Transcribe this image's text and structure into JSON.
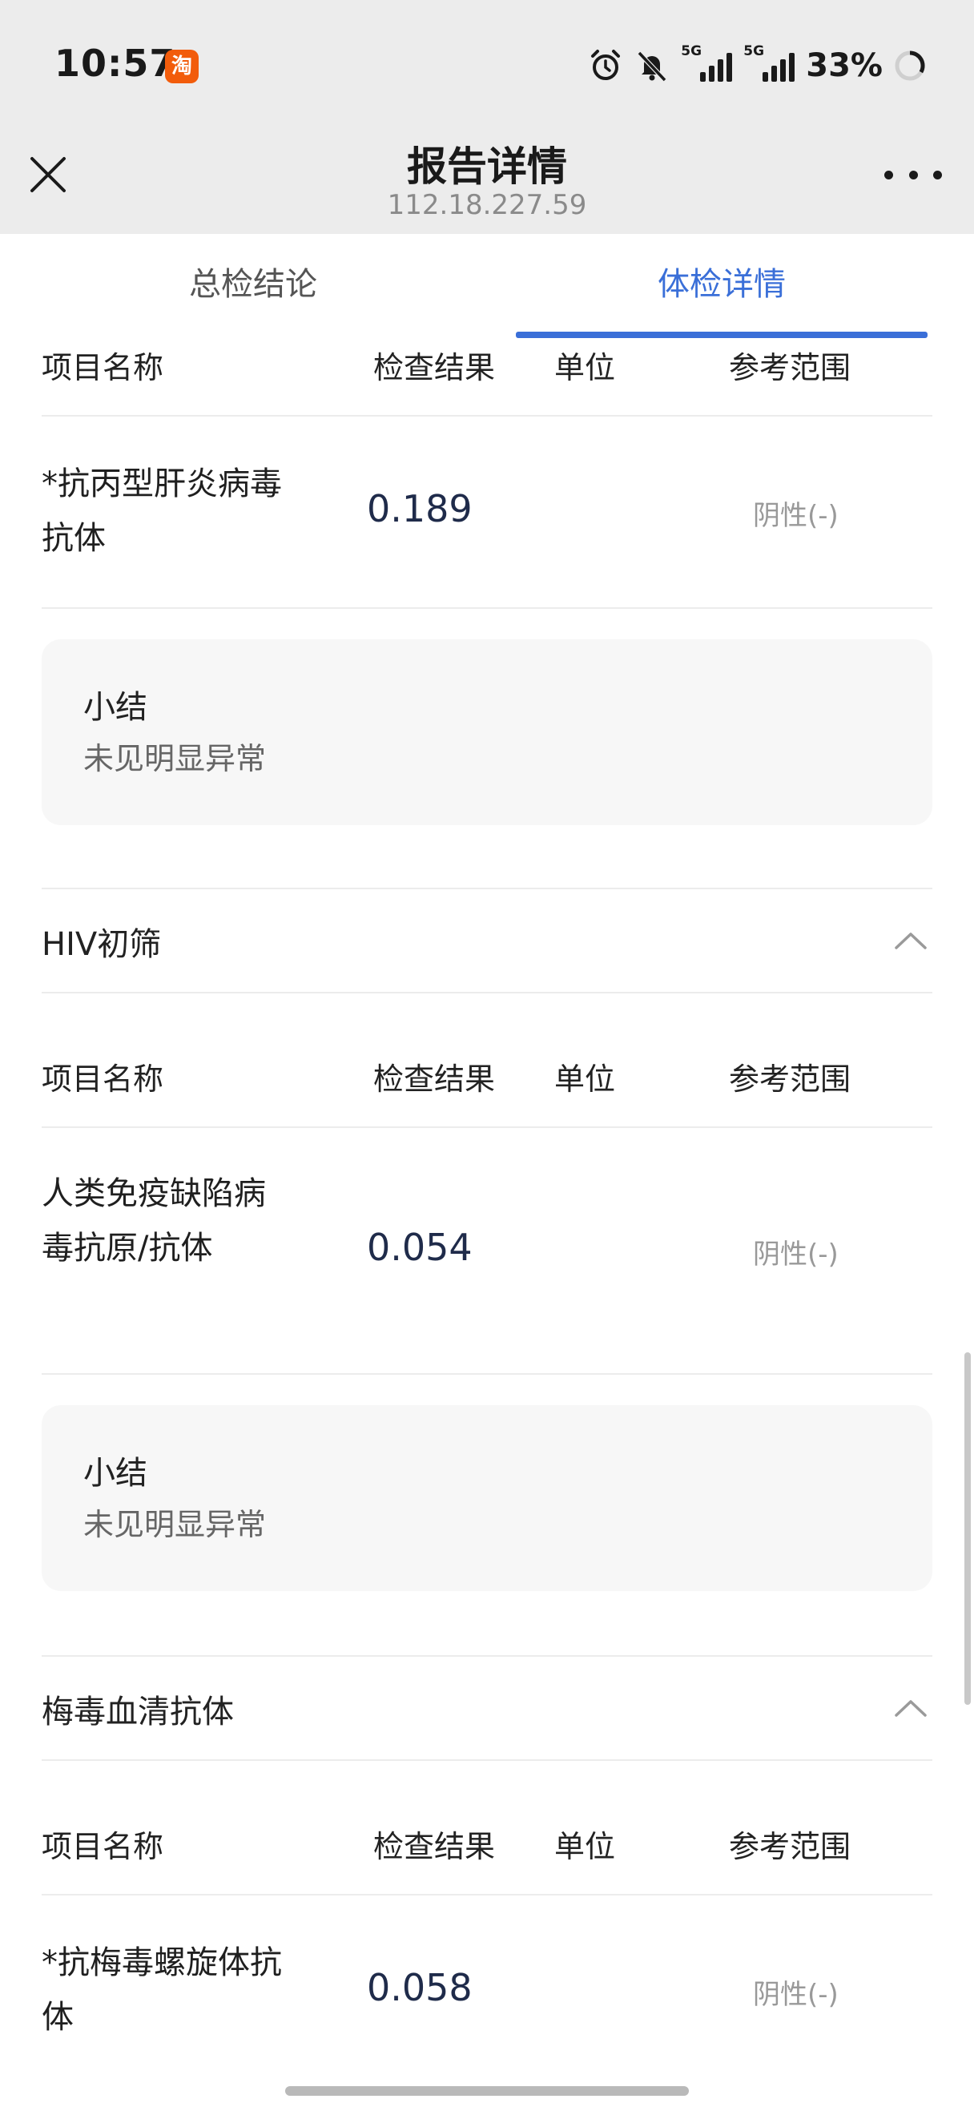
{
  "status_bar": {
    "time": "10:57",
    "taobao_icon_glyph": "淘",
    "signal1_label": "5G",
    "signal2_label": "5G",
    "battery": "33%",
    "icons": [
      "alarm-icon",
      "mute-bell-icon",
      "signal-5g-icon",
      "signal-5g-icon",
      "battery-ring-icon"
    ]
  },
  "nav": {
    "title": "报告详情",
    "subtitle": "112.18.227.59",
    "close_icon": "close-icon",
    "more_icon": "more-icon"
  },
  "tabs": [
    {
      "label": "总检结论",
      "active": false
    },
    {
      "label": "体检详情",
      "active": true
    }
  ],
  "table_header": {
    "name": "项目名称",
    "result": "检查结果",
    "unit": "单位",
    "reference": "参考范围"
  },
  "sections": [
    {
      "title": "",
      "items": [
        {
          "name": "*抗丙型肝炎病毒抗体",
          "result": "0.189",
          "unit": "",
          "reference": "阴性(-)"
        }
      ],
      "summary": {
        "title": "小结",
        "text": "未见明显异常"
      }
    },
    {
      "title": "HIV初筛",
      "items": [
        {
          "name": "人类免疫缺陷病毒抗原/抗体",
          "result": "0.054",
          "unit": "",
          "reference": "阴性(-)"
        }
      ],
      "summary": {
        "title": "小结",
        "text": "未见明显异常"
      }
    },
    {
      "title": "梅毒血清抗体",
      "items": [
        {
          "name": "*抗梅毒螺旋体抗体",
          "result": "0.058",
          "unit": "",
          "reference": "阴性(-)"
        }
      ]
    }
  ],
  "colors": {
    "accent": "#3a6fd8",
    "top_background": "#ececec",
    "summary_background": "#f7f7f7",
    "reference_text": "#999999"
  }
}
